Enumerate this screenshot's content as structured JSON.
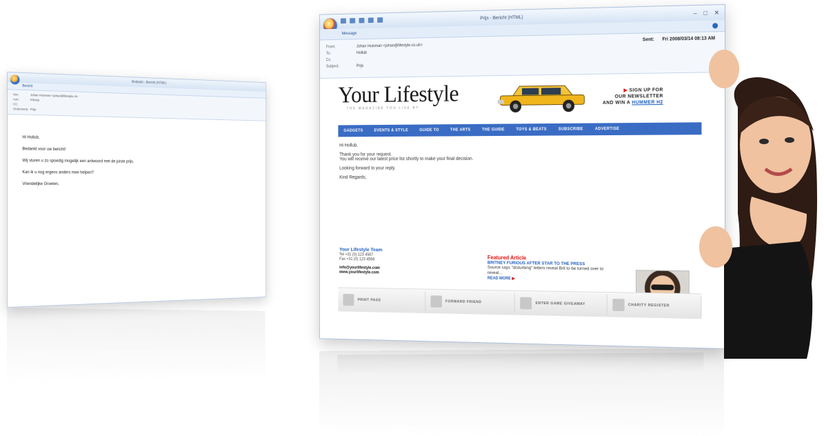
{
  "back_window": {
    "title": "Bedankt - Bericht (HTML)",
    "ribbon_tab": "Bericht",
    "headers": [
      {
        "label": "Van:",
        "value": "Johan Huisman <johan@lifestyle.nl>"
      },
      {
        "label": "Aan:",
        "value": "Inkoop"
      },
      {
        "label": "CC:",
        "value": ""
      },
      {
        "label": "Onderwerp:",
        "value": "Prijs"
      }
    ],
    "body_lines": [
      "Hi Hollub,",
      "Bedankt voor uw bericht!",
      "Wij sturen u zo spoedig mogelijk een antwoord met de juiste prijs.",
      "Kan ik u nog ergens anders mee helpen?",
      "Vriendelijke Groeten,"
    ]
  },
  "front_window": {
    "title": "Prijs - Bericht (HTML)",
    "ribbon_tab": "Message",
    "headers": [
      {
        "label": "From:",
        "value": "Johan Huisman <johan@lifestyle.co.uk>"
      },
      {
        "label": "To:",
        "value": "Hollub"
      },
      {
        "label": "Cc:",
        "value": ""
      },
      {
        "label": "Subject:",
        "value": "Prijs"
      }
    ],
    "sent_label": "Sent:",
    "sent_value": "Fri 2008/03/14 08:13 AM",
    "newsletter": {
      "brand": "Your Lifestyle",
      "tagline": "THE MAGAZINE YOU LIVE BY",
      "signup_line1": "SIGN UP FOR",
      "signup_line2": "OUR NEWSLETTER",
      "signup_line3_prefix": "AND WIN A",
      "signup_line3_link": "HUMMER H2",
      "nav": [
        "GADGETS",
        "EVENTS & STYLE",
        "GUIDE TO",
        "THE ARTS",
        "THE GUIDE",
        "TOYS & BEATS",
        "SUBSCRIBE",
        "ADVERTISE"
      ],
      "mail_lines": [
        "Hi Hollub,",
        "Thank you for your request.",
        "You will receive our latest price list shortly to make your final decision.",
        "Looking forward to your reply.",
        "Kind Regards,"
      ],
      "team_title": "Your Lifestyle Team",
      "team_lines": [
        "Tel +31 (0) 123 4567",
        "Fax +31 (0) 123 4568"
      ],
      "team_links": [
        "info@yourlifestyle.com",
        "www.yourlifestyle.com"
      ],
      "featured_title": "Featured Article",
      "featured_link": "BRITNEY FURIOUS AFTER STAR TO THE PRESS",
      "featured_text": "Source says \"disturbing\" letters reveal Brit to be turned over to reveal... ",
      "featured_more": "READ MORE",
      "strip": [
        "PRINT PAGE",
        "FORWARD FRIEND",
        "ENTER GAME GIVEAWAY",
        "CHARITY REGISTER"
      ]
    }
  }
}
